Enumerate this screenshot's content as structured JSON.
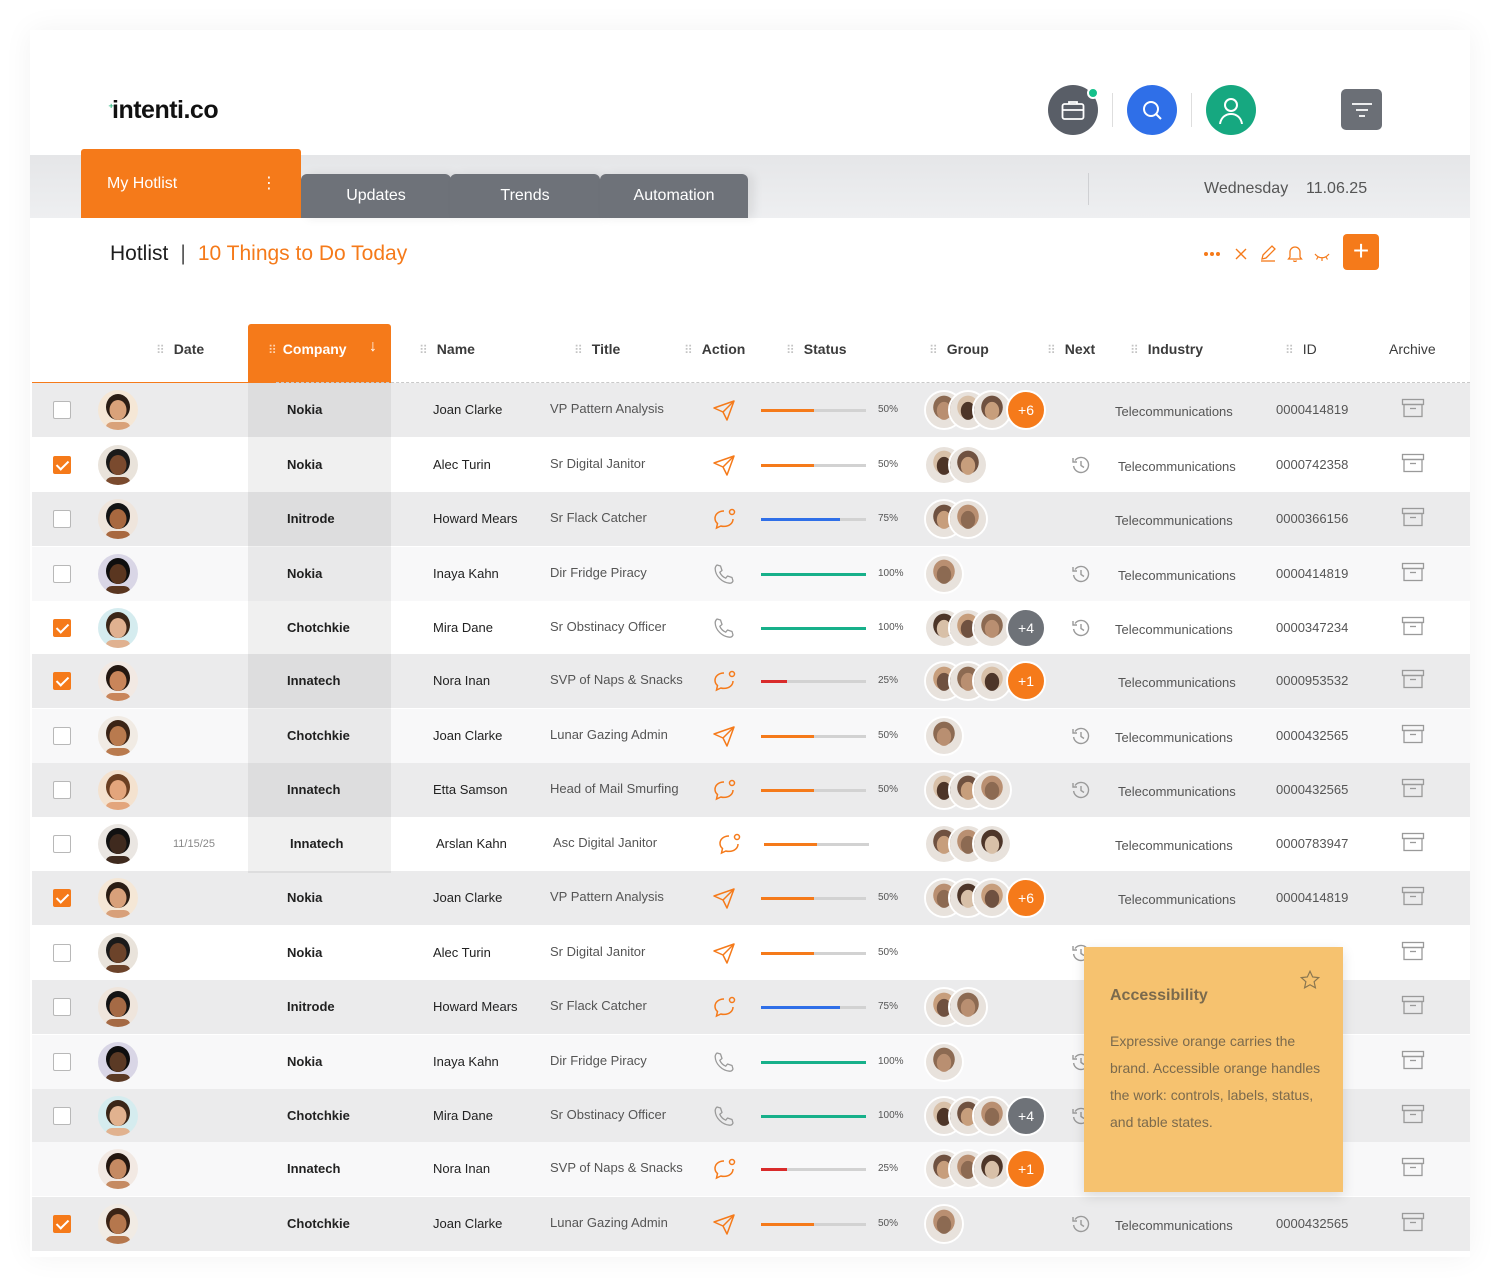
{
  "header": {
    "logo": "intenti.co",
    "icons": [
      "briefcase-icon",
      "search-icon",
      "user-icon",
      "menu-icon"
    ]
  },
  "tabs": {
    "active": "My Hotlist",
    "active_menu": "⋮",
    "others": [
      "Updates",
      "Trends",
      "Automation"
    ]
  },
  "date": {
    "day": "Wednesday",
    "value": "11.06.25"
  },
  "page": {
    "title": "Hotlist",
    "separator": "|",
    "subtitle": "10 Things to Do Today"
  },
  "toolbar": {
    "icons": [
      "more-icon",
      "close-icon",
      "edit-icon",
      "bell-icon",
      "hide-icon"
    ],
    "add_label": "+"
  },
  "columns": {
    "date": "Date",
    "company": "Company",
    "name": "Name",
    "title": "Title",
    "action": "Action",
    "status": "Status",
    "group": "Group",
    "next": "Next",
    "industry": "Industry",
    "id": "ID",
    "archive": "Archive"
  },
  "colors": {
    "accent": "#f57a1a",
    "progress_orange": "#f57a1a",
    "progress_blue": "#2f6fe8",
    "progress_green": "#17b08a",
    "progress_red": "#d92b2b"
  },
  "rows": [
    {
      "checked": false,
      "date": "",
      "company": "Nokia",
      "name": "Joan Clarke",
      "title": "VP Pattern Analysis",
      "action": "send",
      "progress": 50,
      "pct": "50%",
      "group": 3,
      "extra": "+6",
      "next": false,
      "industry": "Telecommunications",
      "id": "0000414819"
    },
    {
      "checked": true,
      "date": "",
      "company": "Nokia",
      "name": "Alec Turin",
      "title": "Sr Digital Janitor",
      "action": "send",
      "progress": 50,
      "pct": "50%",
      "group": 2,
      "extra": "",
      "next": true,
      "industry": "Telecommunications",
      "id": "0000742358"
    },
    {
      "checked": false,
      "date": "",
      "company": "Initrode",
      "name": "Howard Mears",
      "title": "Sr Flack Catcher",
      "action": "chat",
      "progress": 75,
      "pct": "75%",
      "group": 2,
      "extra": "",
      "next": false,
      "industry": "Telecommunications",
      "id": "0000366156"
    },
    {
      "checked": false,
      "date": "",
      "company": "Nokia",
      "name": "Inaya Kahn",
      "title": "Dir Fridge Piracy",
      "action": "phone",
      "progress": 100,
      "pct": "100%",
      "group": 1,
      "extra": "",
      "next": true,
      "industry": "Telecommunications",
      "id": "0000414819"
    },
    {
      "checked": true,
      "date": "",
      "company": "Chotchkie",
      "name": "Mira Dane",
      "title": "Sr Obstinacy Officer",
      "action": "phone",
      "progress": 100,
      "pct": "100%",
      "group": 3,
      "extra": "+4",
      "next": true,
      "industry": "Telecommunications",
      "id": "0000347234"
    },
    {
      "checked": true,
      "date": "",
      "company": "Innatech",
      "name": "Nora Inan",
      "title": "SVP of Naps & Snacks",
      "action": "chat",
      "progress": 25,
      "pct": "25%",
      "group": 3,
      "extra": "+1",
      "next": false,
      "industry": "Telecommunications",
      "id": "0000953532"
    },
    {
      "checked": false,
      "date": "",
      "company": "Chotchkie",
      "name": "Joan Clarke",
      "title": "Lunar Gazing Admin",
      "action": "send",
      "progress": 50,
      "pct": "50%",
      "group": 1,
      "extra": "",
      "next": true,
      "industry": "Telecommunications",
      "id": "0000432565"
    },
    {
      "checked": false,
      "date": "",
      "company": "Innatech",
      "name": "Etta Samson",
      "title": "Head of Mail Smurfing",
      "action": "chat",
      "progress": 50,
      "pct": "50%",
      "group": 3,
      "extra": "",
      "next": true,
      "industry": "Telecommunications",
      "id": "0000432565"
    },
    {
      "checked": false,
      "date": "11/15/25",
      "company": "Innatech",
      "name": "Arslan Kahn",
      "title": "Asc Digital Janitor",
      "action": "chat",
      "progress": 50,
      "pct": "",
      "group": 3,
      "extra": "",
      "next": false,
      "industry": "Telecommunications",
      "id": "0000783947"
    },
    {
      "checked": true,
      "date": "",
      "company": "Nokia",
      "name": "Joan Clarke",
      "title": "VP Pattern Analysis",
      "action": "send",
      "progress": 50,
      "pct": "50%",
      "group": 3,
      "extra": "+6",
      "next": false,
      "industry": "Telecommunications",
      "id": "0000414819"
    },
    {
      "checked": false,
      "date": "",
      "company": "Nokia",
      "name": "Alec Turin",
      "title": "Sr Digital Janitor",
      "action": "send",
      "progress": 50,
      "pct": "50%",
      "group": 0,
      "extra": "",
      "next": true,
      "industry": "",
      "id": ""
    },
    {
      "checked": false,
      "date": "",
      "company": "Initrode",
      "name": "Howard Mears",
      "title": "Sr Flack Catcher",
      "action": "chat",
      "progress": 75,
      "pct": "75%",
      "group": 2,
      "extra": "",
      "next": false,
      "industry": "",
      "id": ""
    },
    {
      "checked": false,
      "date": "",
      "company": "Nokia",
      "name": "Inaya Kahn",
      "title": "Dir Fridge Piracy",
      "action": "phone",
      "progress": 100,
      "pct": "100%",
      "group": 1,
      "extra": "",
      "next": true,
      "industry": "",
      "id": ""
    },
    {
      "checked": false,
      "date": "",
      "company": "Chotchkie",
      "name": "Mira Dane",
      "title": "Sr Obstinacy Officer",
      "action": "phone",
      "progress": 100,
      "pct": "100%",
      "group": 3,
      "extra": "+4",
      "next": true,
      "industry": "",
      "id": ""
    },
    {
      "checked": null,
      "date": "",
      "company": "Innatech",
      "name": "Nora Inan",
      "title": "SVP of Naps & Snacks",
      "action": "chat",
      "progress": 25,
      "pct": "25%",
      "group": 3,
      "extra": "+1",
      "next": false,
      "industry": "",
      "id": ""
    },
    {
      "checked": true,
      "date": "",
      "company": "Chotchkie",
      "name": "Joan Clarke",
      "title": "Lunar Gazing Admin",
      "action": "send",
      "progress": 50,
      "pct": "50%",
      "group": 1,
      "extra": "",
      "next": true,
      "industry": "Telecommunications",
      "id": "0000432565"
    }
  ],
  "tooltip": {
    "title": "Accessibility",
    "body": "Expressive orange carries the brand. Accessible orange handles the work: controls, labels, status, and table states."
  }
}
